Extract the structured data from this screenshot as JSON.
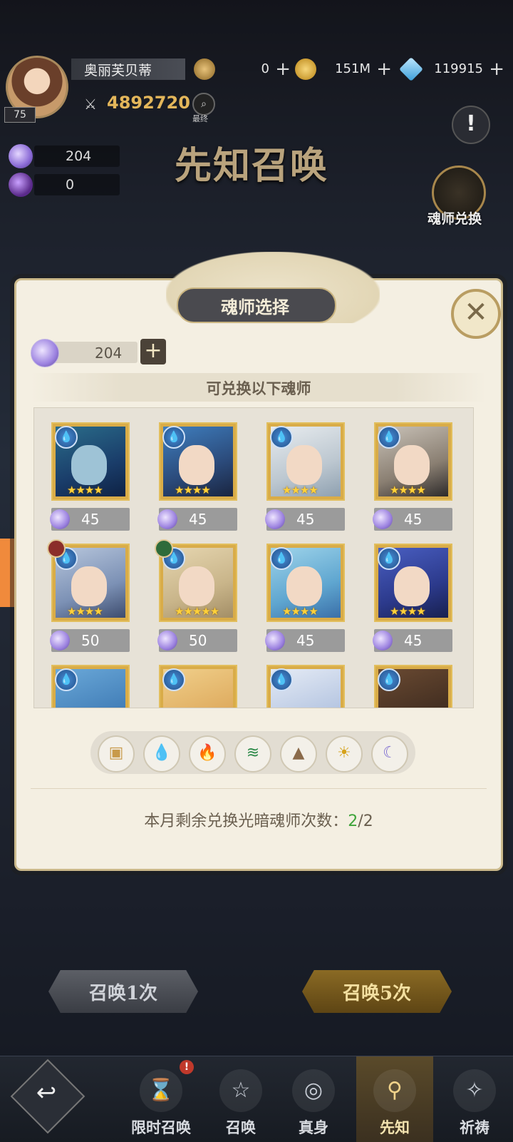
{
  "player": {
    "name": "奥丽芙贝蒂",
    "level": "75",
    "power": "4892720",
    "rank_label": "最终"
  },
  "resources": {
    "medal": {
      "value": "0",
      "icon": "medal-coin-icon"
    },
    "gold": {
      "value": "151M",
      "icon": "gold-coin-icon"
    },
    "diamond": {
      "value": "119915",
      "icon": "diamond-icon"
    }
  },
  "side_resources": [
    {
      "value": "204",
      "icon": "soul-orb-icon"
    },
    {
      "value": "0",
      "icon": "dark-orb-icon"
    }
  ],
  "banner": {
    "title": "先知召唤"
  },
  "exchange": {
    "label": "魂师兑换"
  },
  "alert": {
    "symbol": "!"
  },
  "modal": {
    "title": "魂师选择",
    "close": "✕",
    "balance": "204",
    "subheader": "可兑换以下魂师",
    "cards": [
      {
        "cost": "45",
        "stars": "★★★★",
        "element": "water"
      },
      {
        "cost": "45",
        "stars": "★★★★",
        "element": "water"
      },
      {
        "cost": "45",
        "stars": "★★★★",
        "element": "water"
      },
      {
        "cost": "45",
        "stars": "★★★★",
        "element": "water"
      },
      {
        "cost": "50",
        "stars": "★★★★",
        "element": "water",
        "badge": "fire"
      },
      {
        "cost": "50",
        "stars": "★★★★★",
        "element": "water",
        "badge": "wind"
      },
      {
        "cost": "45",
        "stars": "★★★★",
        "element": "water"
      },
      {
        "cost": "45",
        "stars": "★★★★",
        "element": "water"
      },
      {
        "cost": "",
        "stars": "",
        "element": "water"
      },
      {
        "cost": "",
        "stars": "",
        "element": "water"
      },
      {
        "cost": "",
        "stars": "",
        "element": "water"
      },
      {
        "cost": "",
        "stars": "",
        "element": "water"
      }
    ],
    "filters": [
      "all-box-icon",
      "water-drop-icon",
      "fire-icon",
      "wind-icon",
      "earth-mountain-icon",
      "light-sun-icon",
      "dark-moon-icon"
    ],
    "remaining_label": "本月剩余兑换光暗魂师次数：",
    "remaining_used": "2",
    "remaining_total": "/2"
  },
  "summon": {
    "once": "召唤1次",
    "five": "召唤5次"
  },
  "tabs": [
    {
      "label": "限时召唤",
      "icon": "hourglass-icon"
    },
    {
      "label": "召唤",
      "icon": "star-icon"
    },
    {
      "label": "真身",
      "icon": "planet-icon"
    },
    {
      "label": "先知",
      "icon": "prophet-icon"
    },
    {
      "label": "祈祷",
      "icon": "pray-icon"
    }
  ],
  "colors": {
    "accent_gold": "#e3b65a",
    "modal_bg": "#f4efe2",
    "remain_highlight": "#3ea43a"
  }
}
